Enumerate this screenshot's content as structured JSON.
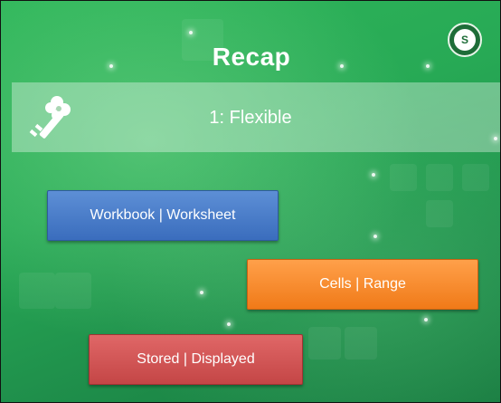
{
  "slide": {
    "title": "Recap",
    "banner_text": "1: Flexible",
    "logo_text": "S",
    "buttons": {
      "workbook_worksheet": "Workbook | Worksheet",
      "cells_range": "Cells | Range",
      "stored_displayed": "Stored | Displayed"
    }
  },
  "colors": {
    "background": "#27a955",
    "blue_button": "#3a6dbd",
    "orange_button": "#f07a18",
    "red_button": "#c44646",
    "banner": "#ffffff"
  },
  "icons": {
    "banner": "key-icon",
    "logo": "university-logo-icon"
  }
}
